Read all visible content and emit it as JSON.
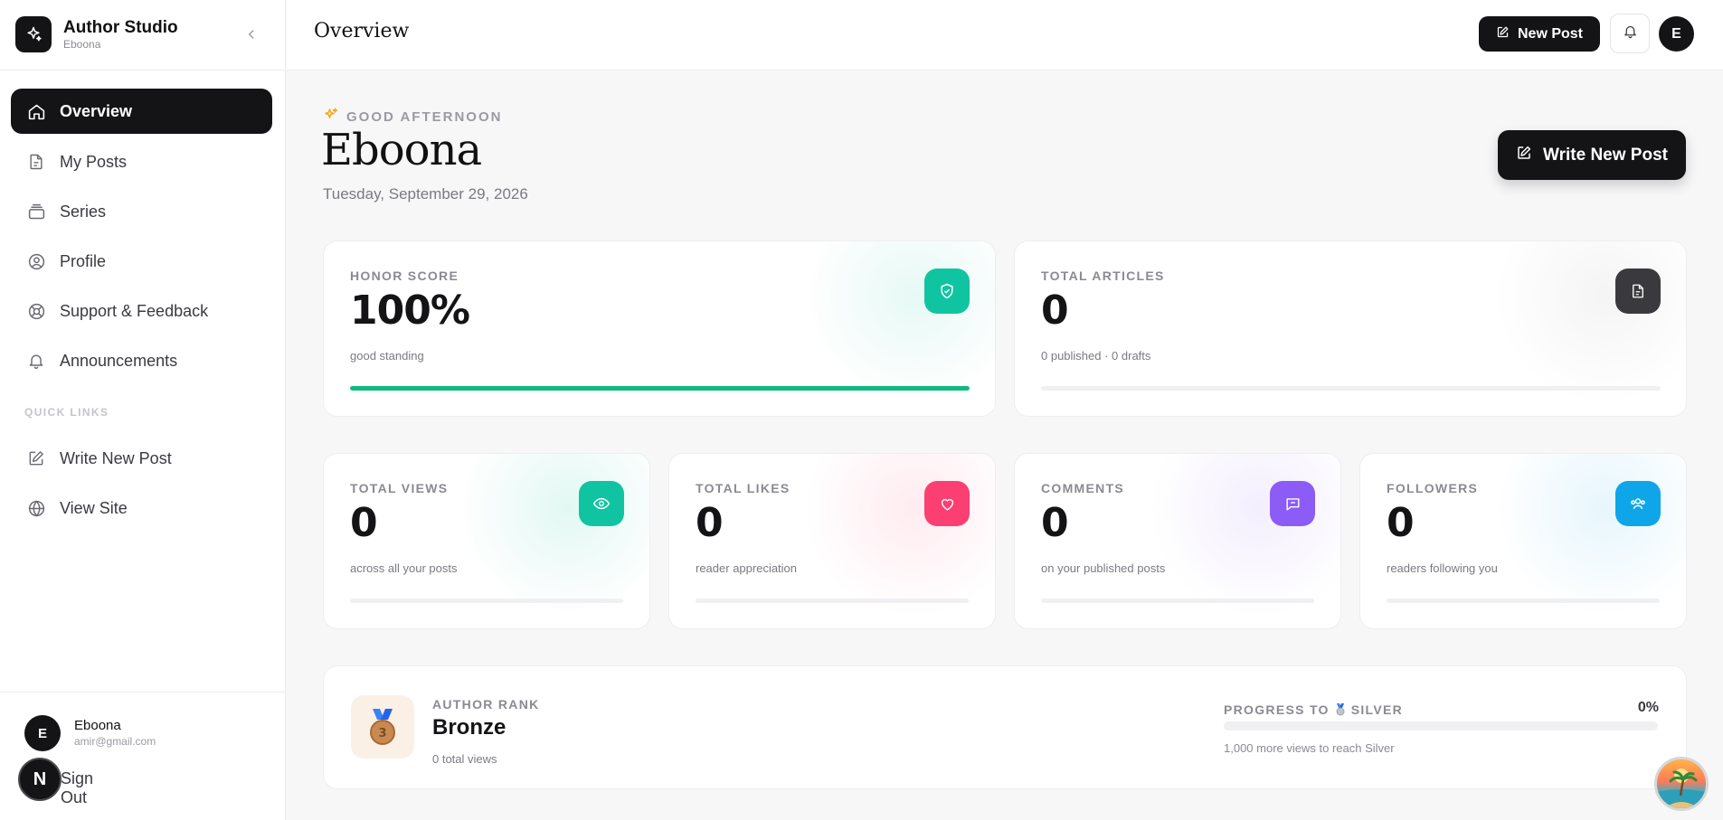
{
  "brand": {
    "title": "Author Studio",
    "subtitle": "Eboona"
  },
  "nav": {
    "items": [
      {
        "label": "Overview",
        "icon": "home-icon",
        "active": true
      },
      {
        "label": "My Posts",
        "icon": "file-icon"
      },
      {
        "label": "Series",
        "icon": "layers-icon"
      },
      {
        "label": "Profile",
        "icon": "user-circle-icon"
      },
      {
        "label": "Support & Feedback",
        "icon": "lifebuoy-icon"
      },
      {
        "label": "Announcements",
        "icon": "bell-icon"
      }
    ],
    "quick_links_label": "QUICK LINKS",
    "quick_links": [
      {
        "label": "Write New Post",
        "icon": "edit-icon"
      },
      {
        "label": "View Site",
        "icon": "globe-icon"
      }
    ]
  },
  "user": {
    "initial": "E",
    "name": "Eboona",
    "email": "amir@gmail.com"
  },
  "signout": {
    "badge": "N",
    "label": "Sign Out"
  },
  "topbar": {
    "title": "Overview",
    "new_post_label": "New Post",
    "avatar_initial": "E"
  },
  "greeting": {
    "label": "GOOD AFTERNOON",
    "name": "Eboona",
    "date": "Tuesday, September 29, 2026",
    "write_button": "Write New Post"
  },
  "stats": {
    "honor": {
      "label": "HONOR SCORE",
      "value": "100%",
      "sub": "good standing",
      "progress": 1.0,
      "color": "#10b981"
    },
    "articles": {
      "label": "TOTAL ARTICLES",
      "value": "0",
      "sub": "0 published · 0 drafts",
      "progress": 0
    },
    "views": {
      "label": "TOTAL VIEWS",
      "value": "0",
      "sub": "across all your posts",
      "progress": 0,
      "color": "#10c4a1"
    },
    "likes": {
      "label": "TOTAL LIKES",
      "value": "0",
      "sub": "reader appreciation",
      "progress": 0,
      "color": "#fb3f72"
    },
    "comments": {
      "label": "COMMENTS",
      "value": "0",
      "sub": "on your published posts",
      "progress": 0,
      "color": "#8b5cf6"
    },
    "followers": {
      "label": "FOLLOWERS",
      "value": "0",
      "sub": "readers following you",
      "progress": 0,
      "color": "#0ea5e9"
    }
  },
  "rank": {
    "label": "AUTHOR RANK",
    "name": "Bronze",
    "sub": "0 total views",
    "progress_label": "PROGRESS TO",
    "next_rank": "SILVER",
    "progress_pct": "0%",
    "progress": 0,
    "progress_sub": "1,000 more views to reach Silver"
  }
}
